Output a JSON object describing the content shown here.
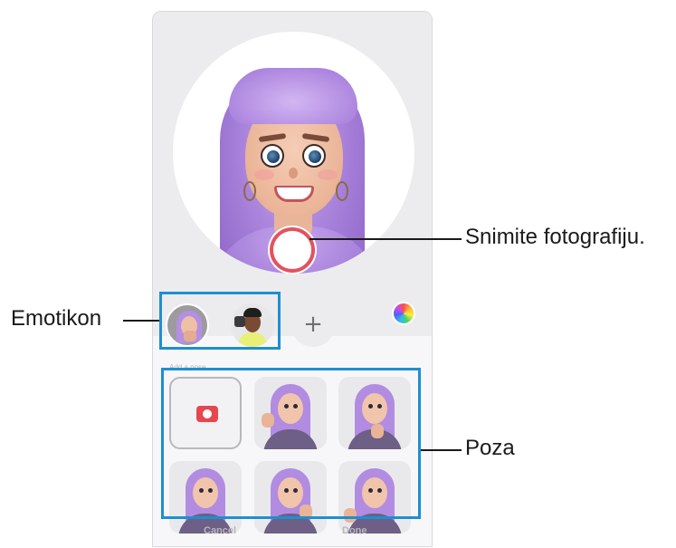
{
  "callouts": {
    "capture": "Snimite fotografiju.",
    "emoji": "Emotikon",
    "pose": "Poza"
  },
  "panel": {
    "section_label": "Add a pose",
    "cancel_label": "Cancel",
    "done_label": "Done"
  },
  "emoji_row": {
    "add_symbol": "+"
  },
  "colors": {
    "capture_ring": "#e2535f",
    "highlight": "#1e8fd0",
    "avatar_hair": "#a57ed9"
  },
  "icons": [
    "camera-icon",
    "color-palette-icon",
    "add-icon"
  ]
}
